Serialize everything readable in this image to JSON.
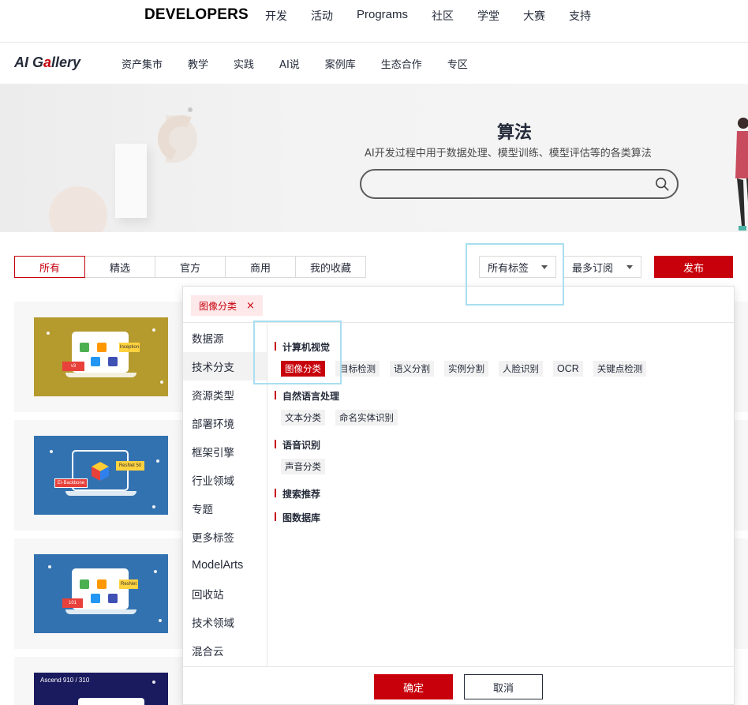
{
  "topbar": {
    "brand": "DEVELOPERS",
    "nav": [
      "开发",
      "活动",
      "Programs",
      "社区",
      "学堂",
      "大赛",
      "支持"
    ]
  },
  "subbar": {
    "logo_prefix": "AI G",
    "logo_accent": "a",
    "logo_suffix": "llery",
    "nav": [
      "资产集市",
      "教学",
      "实践",
      "AI说",
      "案例库",
      "生态合作",
      "专区"
    ]
  },
  "banner": {
    "title": "算法",
    "description": "AI开发过程中用于数据处理、模型训练、模型评估等的各类算法",
    "search_placeholder": ""
  },
  "filters": {
    "tabs": [
      "所有",
      "精选",
      "官方",
      "商用",
      "我的收藏"
    ],
    "active_tab": "所有",
    "tag_dropdown": "所有标签",
    "sort_dropdown": "最多订阅",
    "publish": "发布"
  },
  "cards": [
    {
      "bg": "#b59a2e",
      "chips": [
        "Inception",
        "v3"
      ]
    },
    {
      "bg": "#3372b0",
      "chips": [
        "ResNet 50",
        "EI-Backbone"
      ]
    },
    {
      "bg": "#3372b0",
      "chips": [
        "ResNet",
        "101"
      ]
    },
    {
      "bg": "#1a1a5e",
      "chips": [
        "Ascend 910 / 310"
      ]
    }
  ],
  "tag_panel": {
    "selected_chip": "图像分类",
    "chip_close": "×",
    "categories": [
      "数据源",
      "技术分支",
      "资源类型",
      "部署环境",
      "框架引擎",
      "行业领域",
      "专题",
      "更多标签",
      "ModelArts",
      "回收站",
      "技术领域",
      "混合云"
    ],
    "active_category": "技术分支",
    "groups": [
      {
        "title": "计算机视觉",
        "tags": [
          "图像分类",
          "目标检测",
          "语义分割",
          "实例分割",
          "人脸识别",
          "OCR",
          "关键点检测"
        ]
      },
      {
        "title": "自然语言处理",
        "tags": [
          "文本分类",
          "命名实体识别"
        ]
      },
      {
        "title": "语音识别",
        "tags": [
          "声音分类"
        ]
      },
      {
        "title": "搜索推荐",
        "tags": []
      },
      {
        "title": "图数据库",
        "tags": []
      }
    ],
    "selected_tag": "图像分类",
    "confirm": "确定",
    "cancel": "取消"
  },
  "colors": {
    "brand_red": "#c7000b",
    "highlight": "#a8dff0"
  }
}
